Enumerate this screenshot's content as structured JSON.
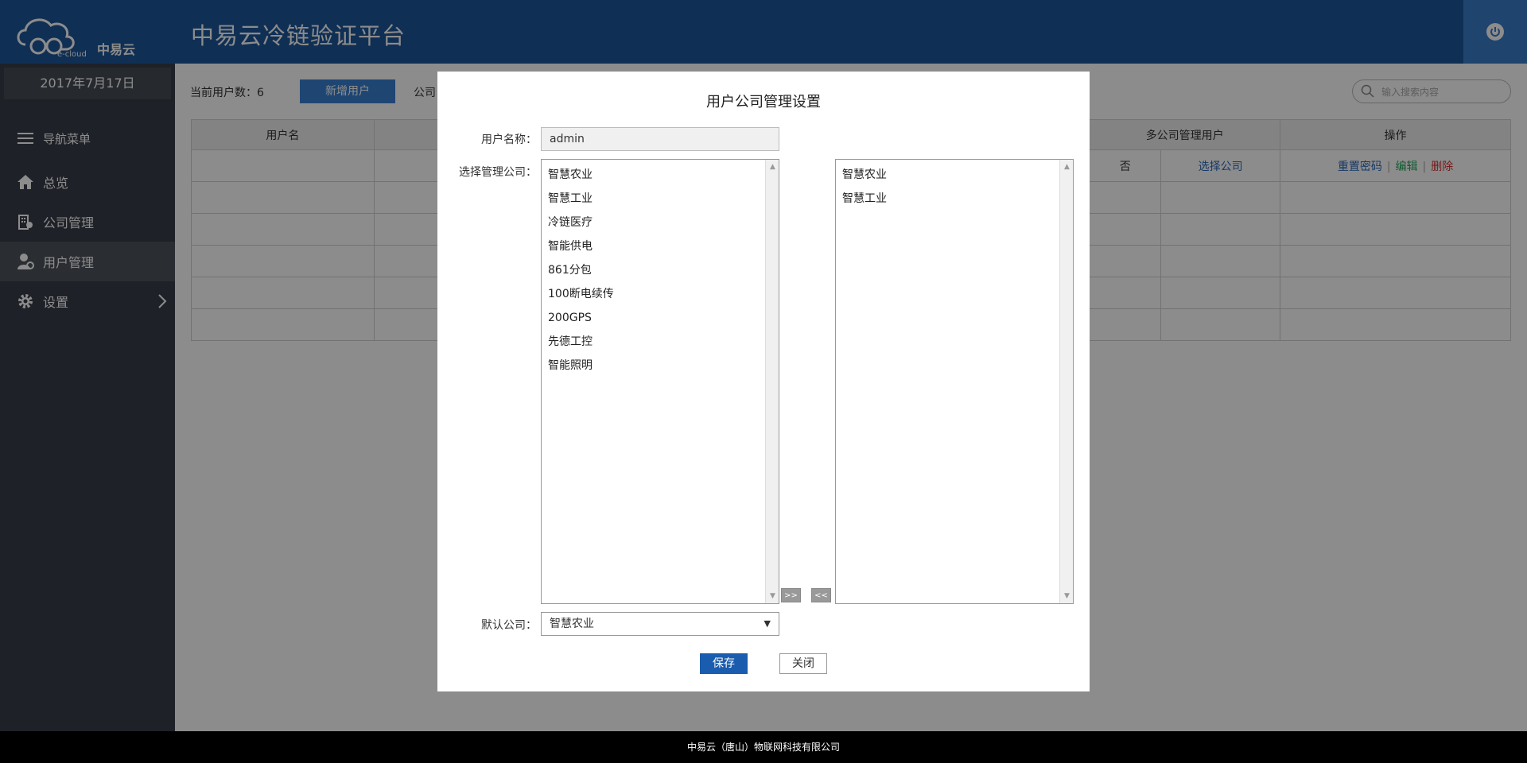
{
  "header": {
    "logo_en": "e-cloud",
    "logo_cn": "中易云",
    "title": "中易云冷链验证平台"
  },
  "sidebar": {
    "date": "2017年7月17日",
    "menu_title": "导航菜单",
    "items": [
      {
        "label": "总览",
        "icon": "home-icon"
      },
      {
        "label": "公司管理",
        "icon": "building-icon"
      },
      {
        "label": "用户管理",
        "icon": "user-icon",
        "active": true
      },
      {
        "label": "设置",
        "icon": "gear-icon"
      }
    ]
  },
  "main": {
    "user_count": "当前用户数：6",
    "new_user_label": "新增用户",
    "company_label": "公司",
    "search_placeholder": "输入搜索内容",
    "table": {
      "headers": [
        "用户名",
        "多公司管理用户",
        "操作"
      ],
      "rows": [
        {
          "multi": "否",
          "select": "选择公司",
          "reset": "重置密码",
          "edit": "编辑",
          "delete": "删除"
        }
      ]
    }
  },
  "modal": {
    "title": "用户公司管理设置",
    "name_label": "用户名称：",
    "name_value": "admin",
    "select_label": "选择管理公司：",
    "available": [
      "智慧农业",
      "智慧工业",
      "冷链医疗",
      "智能供电",
      "861分包",
      "100断电续传",
      "200GPS",
      "先德工控",
      "智能照明"
    ],
    "selected": [
      "智慧农业",
      "智慧工业"
    ],
    "add_btn": ">>",
    "remove_btn": "<<",
    "default_label": "默认公司：",
    "default_value": "智慧农业",
    "save_label": "保存",
    "close_label": "关闭"
  },
  "footer": {
    "text": "中易云（唐山）物联网科技有限公司"
  },
  "colors": {
    "header_bg": "#1e5799",
    "sidebar_bg": "#373d47",
    "primary_button": "#1a5cad"
  }
}
